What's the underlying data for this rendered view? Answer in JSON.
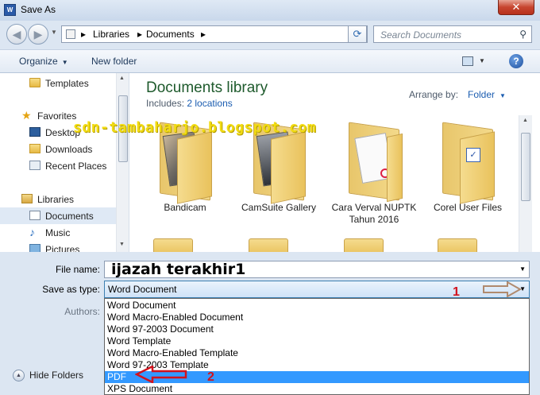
{
  "window": {
    "title": "Save As",
    "close_glyph": "✕",
    "app_icon": "W"
  },
  "address": {
    "breadcrumbs": [
      "Libraries",
      "Documents"
    ],
    "search_placeholder": "Search Documents"
  },
  "toolbar": {
    "organize": "Organize",
    "new_folder": "New folder"
  },
  "nav": {
    "items": [
      {
        "label": "Templates",
        "icon": "folder-icon"
      },
      {
        "label": "Favorites",
        "icon": "star-icon"
      },
      {
        "label": "Desktop",
        "icon": "desktop-icon"
      },
      {
        "label": "Downloads",
        "icon": "downloads-icon"
      },
      {
        "label": "Recent Places",
        "icon": "recent-places-icon"
      },
      {
        "label": "Libraries",
        "icon": "libraries-icon"
      },
      {
        "label": "Documents",
        "icon": "document-icon",
        "selected": true
      },
      {
        "label": "Music",
        "icon": "music-icon"
      },
      {
        "label": "Pictures",
        "icon": "pictures-icon"
      }
    ]
  },
  "library": {
    "title": "Documents library",
    "includes_label": "Includes:",
    "includes_link": "2 locations",
    "arrange_label": "Arrange by:",
    "arrange_value": "Folder"
  },
  "folders": [
    {
      "name": "Bandicam"
    },
    {
      "name": "CamSuite Gallery"
    },
    {
      "name": "Cara Verval NUPTK Tahun 2016"
    },
    {
      "name": "Corel User Files"
    }
  ],
  "watermark": "sdn-tambaharjo.blogspot.com",
  "form": {
    "file_name_label": "File name:",
    "file_name_value": "ijazah terakhir1",
    "save_type_label": "Save as type:",
    "save_type_value": "Word Document",
    "authors_label": "Authors:"
  },
  "type_options": [
    "Word Document",
    "Word Macro-Enabled Document",
    "Word 97-2003 Document",
    "Word Template",
    "Word Macro-Enabled Template",
    "Word 97-2003 Template",
    "PDF",
    "XPS Document"
  ],
  "selected_option": "PDF",
  "hide_folders": "Hide Folders",
  "annotations": {
    "one": "1",
    "two": "2",
    "color": "#d2121d"
  }
}
